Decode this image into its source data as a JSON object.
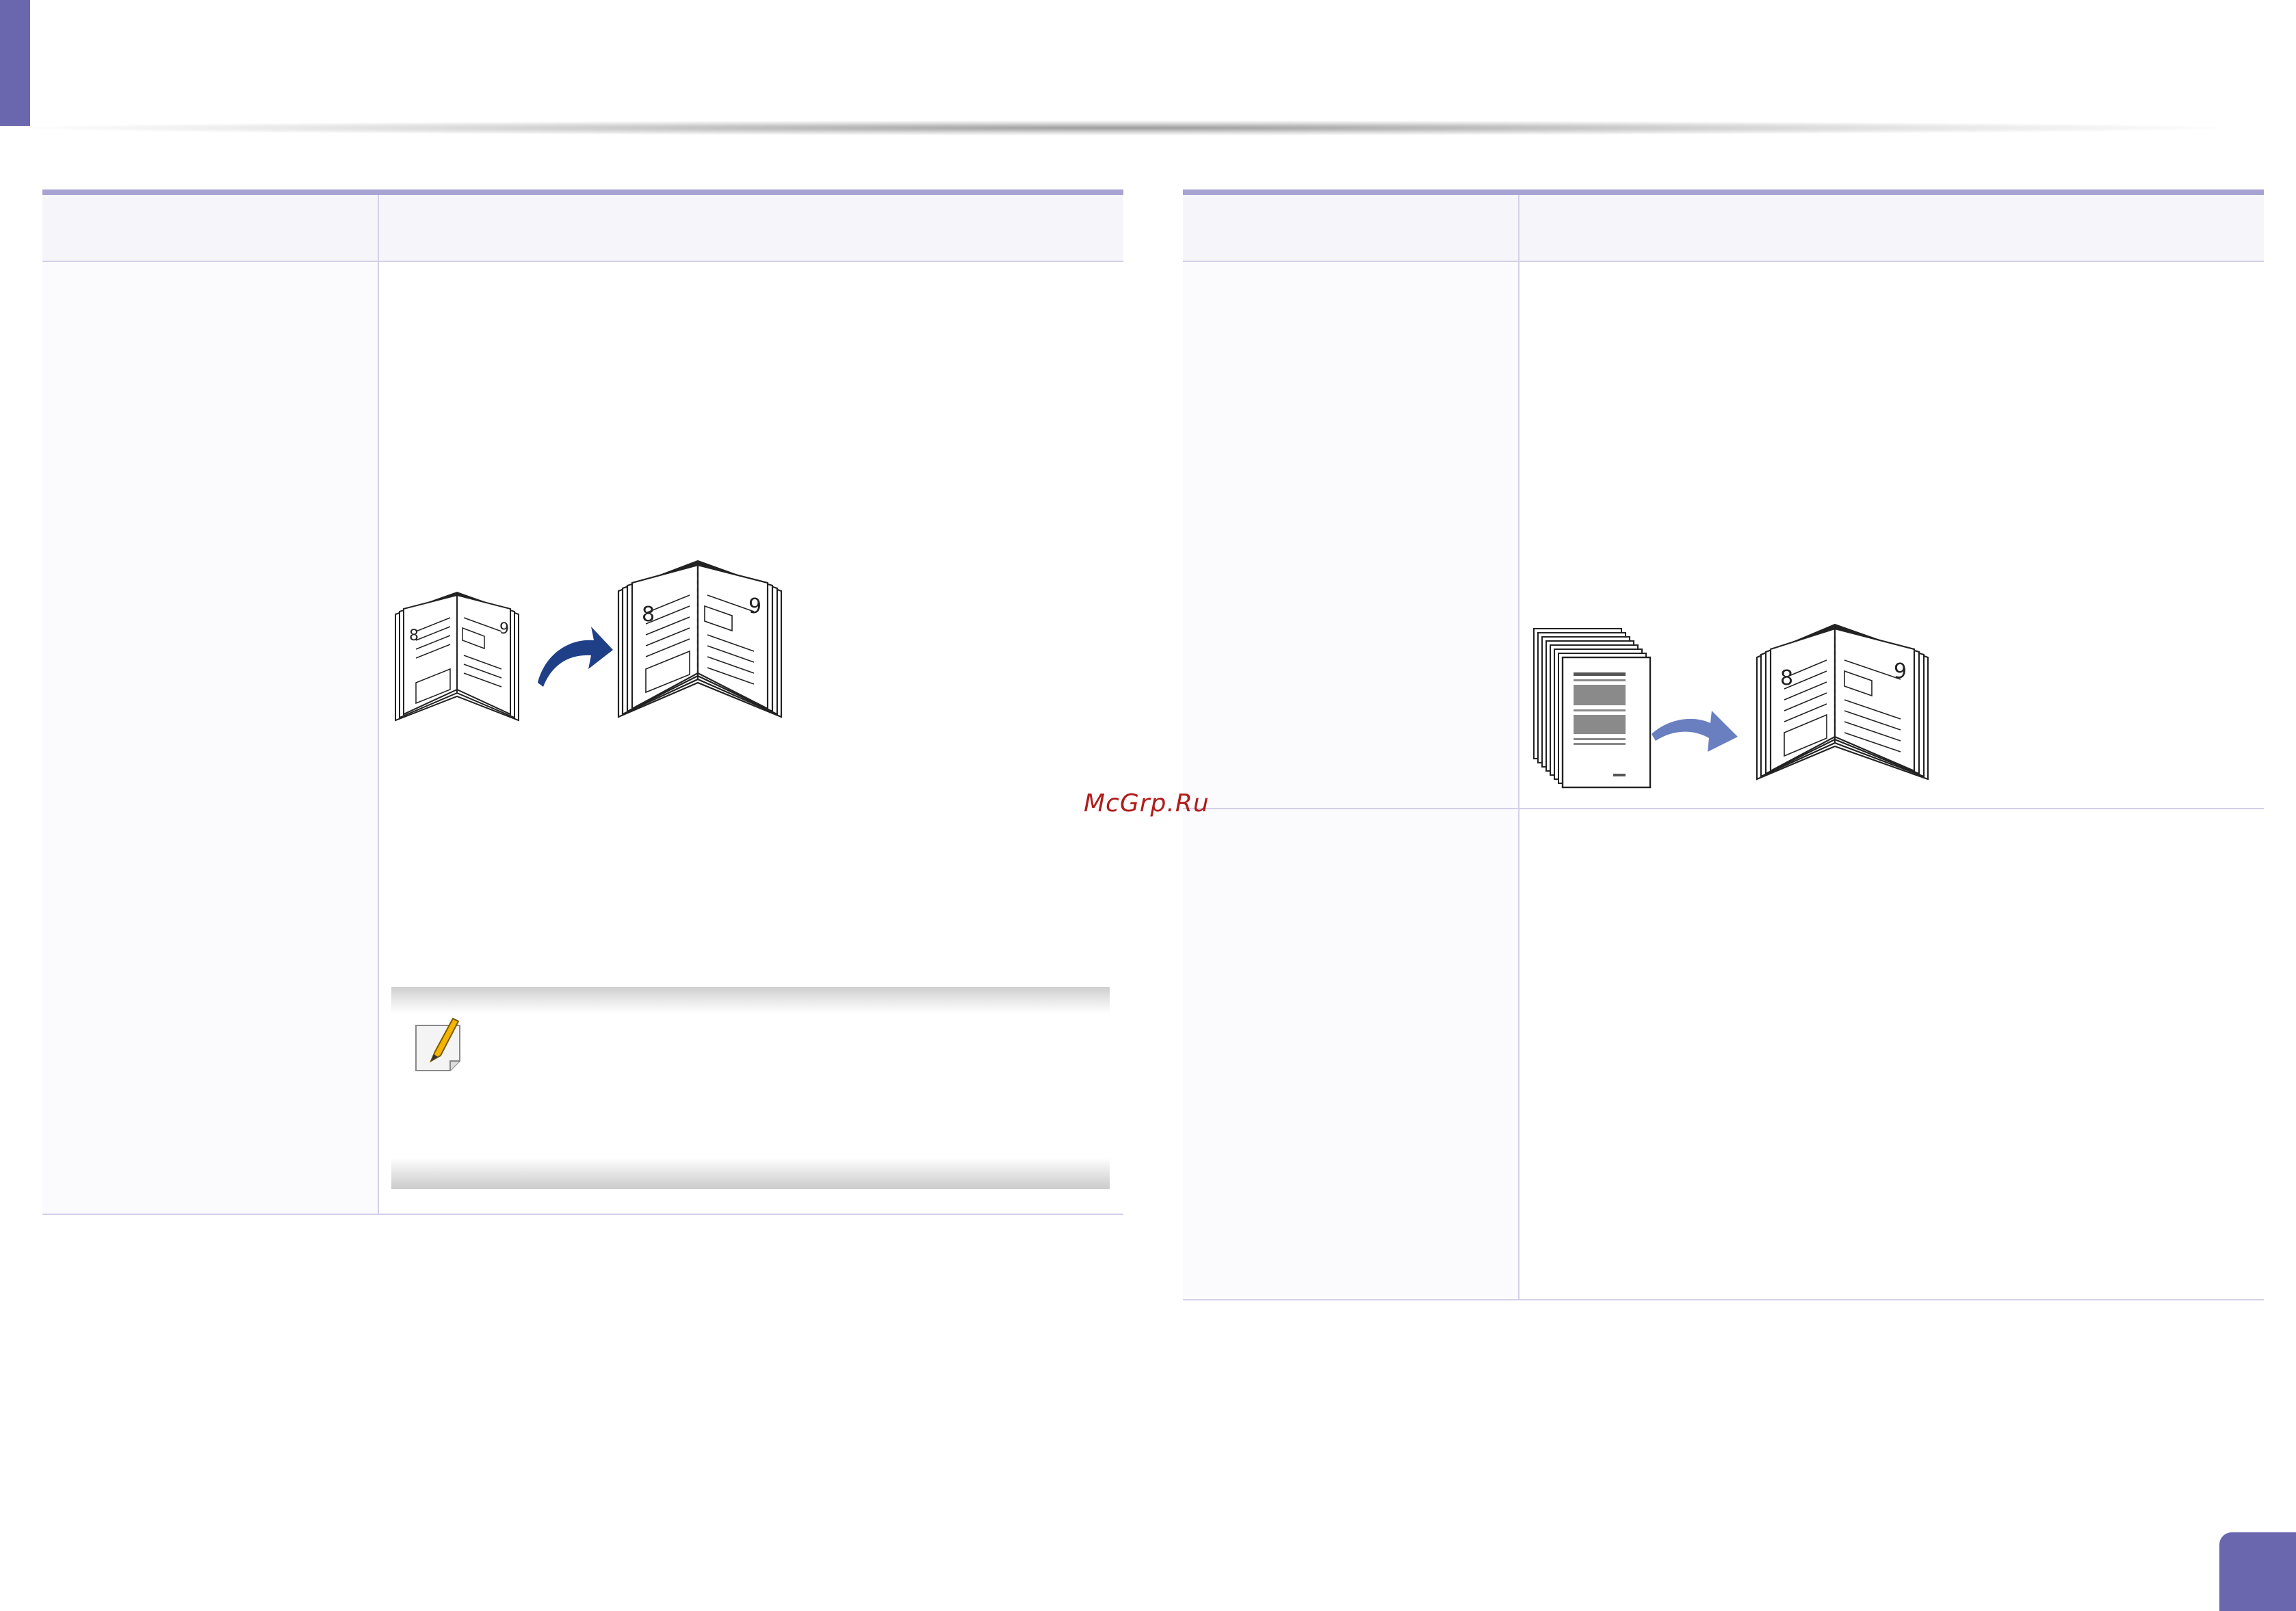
{
  "watermark": {
    "text": "McGrp.Ru"
  },
  "colors": {
    "accent": "#6b67ae",
    "rule": "#a7a3d3",
    "arrow_dark": "#1f3f86",
    "arrow_light": "#6a7fc0"
  },
  "icons": {
    "note": "note-pencil-icon",
    "booklet_small": "small-booklet-icon",
    "booklet_large": "large-booklet-icon",
    "page_stack": "page-stack-icon"
  },
  "illustration_labels": {
    "left_page": "8",
    "right_page": "9"
  }
}
